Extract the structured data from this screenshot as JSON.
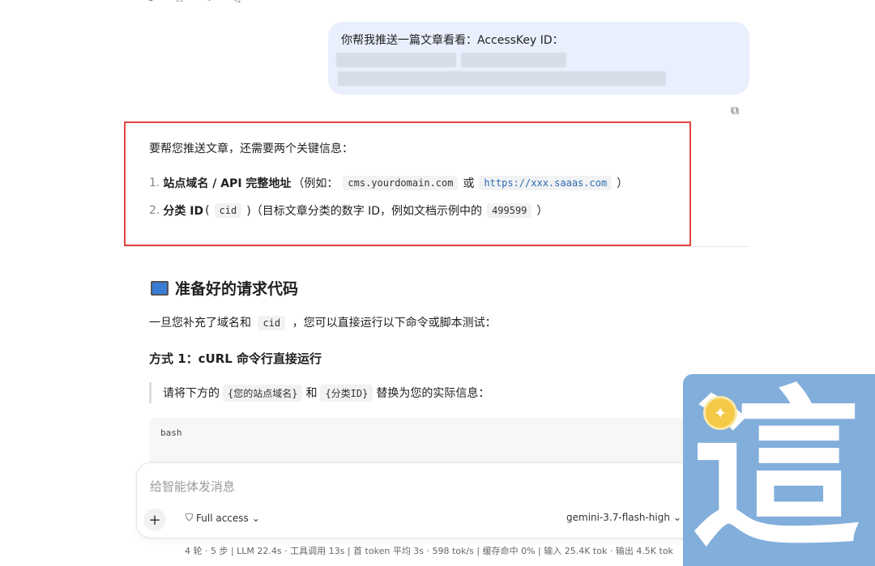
{
  "top_actions": [
    "↻",
    "⧉",
    "✎",
    "◁"
  ],
  "user_message": {
    "text": "你帮我推送一篇文章看看：AccessKey ID："
  },
  "assistant": {
    "intro": "要帮您推送文章，还需要两个关键信息：",
    "items": [
      {
        "num": "1.",
        "bold": "站点域名 / API 完整地址",
        "pre": "（例如：",
        "code1": "cms.yourdomain.com",
        "mid": "或",
        "code2": "https://xxx.saaas.com",
        "post": "）"
      },
      {
        "num": "2.",
        "bold": "分类 ID",
        "pre": "(",
        "code1": "cid",
        "mid": ")（目标文章分类的数字 ID，例如文档示例中的",
        "code2": "499599",
        "post": "）"
      }
    ],
    "section_title": "准备好的请求代码",
    "section_para_pre": "一旦您补充了域名和",
    "section_para_code": "cid",
    "section_para_post": "，您可以直接运行以下命令或脚本测试：",
    "method_title": "方式 1：cURL 命令行直接运行",
    "quote_pre": "请将下方的",
    "quote_code1": "{您的站点域名}",
    "quote_mid": "和",
    "quote_code2": "{分类ID}",
    "quote_post": "替换为您的实际信息：",
    "code_lang": "bash"
  },
  "input": {
    "placeholder": "给智能体发消息",
    "access_label": "Full access",
    "model_label": "gemini-3.7-flash-high"
  },
  "status_bar": "4 轮 · 5 步 | LLM 22.4s · 工具调用 13s | 首 token 平均 3s · 598 tok/s | 缓存命中 0% | 输入 25.4K tok · 输出 4.5K tok",
  "watermark": {
    "char": "這"
  },
  "colors": {
    "highlight_border": "#e0443e",
    "user_bubble": "#e9effc",
    "watermark_bg": "#82aedb"
  }
}
